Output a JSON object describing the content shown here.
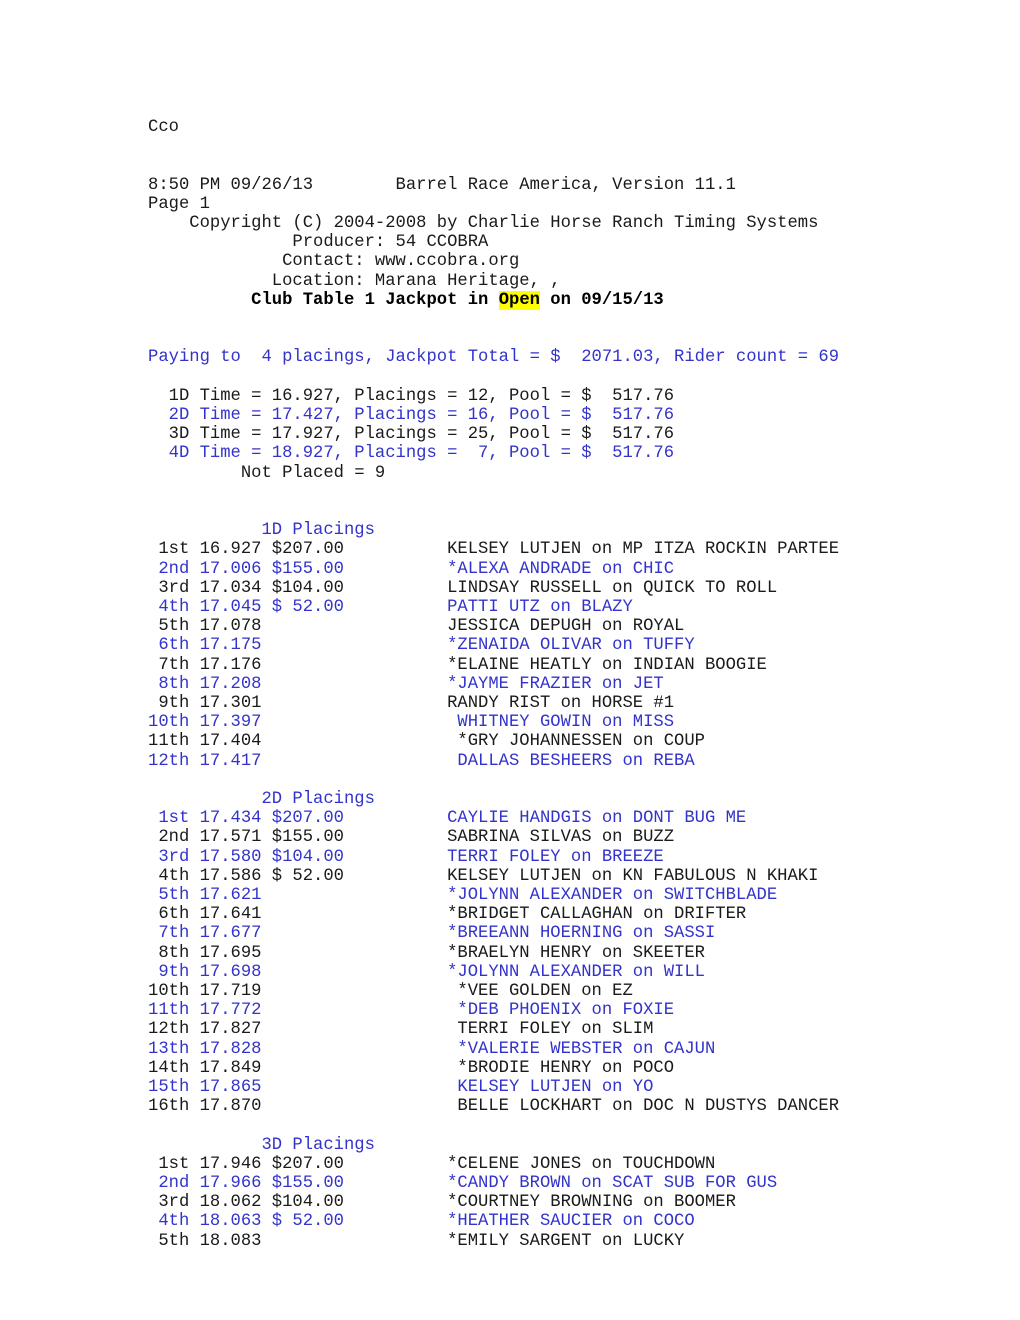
{
  "document": {
    "doc_label": "Cco",
    "timestamp_line": "8:50 PM 09/26/13",
    "app_title": "Barrel Race America, Version 11.1",
    "page_label": "Page 1",
    "copyright": "Copyright (C) 2004-2008 by Charlie Horse Ranch Timing Systems",
    "producer": "Producer: 54 CCOBRA",
    "contact": "Contact: www.ccobra.org",
    "location": "Location: Marana Heritage, ,",
    "title_prefix": "Club Table 1 Jackpot in ",
    "title_highlight": "Open",
    "title_suffix": " on 09/15/13"
  },
  "summary": {
    "paying_line": "Paying to  4 placings, Jackpot Total = $  2071.03, Rider count = 69",
    "divisions": [
      {
        "text": "1D Time = 16.927, Placings = 12, Pool = $  517.76",
        "color": "black"
      },
      {
        "text": "2D Time = 17.427, Placings = 16, Pool = $  517.76",
        "color": "blue"
      },
      {
        "text": "3D Time = 17.927, Placings = 25, Pool = $  517.76",
        "color": "black"
      },
      {
        "text": "4D Time = 18.927, Placings =  7, Pool = $  517.76",
        "color": "blue"
      }
    ],
    "not_placed": "Not Placed = 9"
  },
  "sections": [
    {
      "heading": "1D Placings",
      "rows": [
        {
          "left": " 1st 16.927 $207.00",
          "right": "KELSEY LUTJEN on MP ITZA ROCKIN PARTEE",
          "color": "black"
        },
        {
          "left": " 2nd 17.006 $155.00",
          "right": "*ALEXA ANDRADE on CHIC",
          "color": "blue"
        },
        {
          "left": " 3rd 17.034 $104.00",
          "right": "LINDSAY RUSSELL on QUICK TO ROLL",
          "color": "black"
        },
        {
          "left": " 4th 17.045 $ 52.00",
          "right": "PATTI UTZ on BLAZY",
          "color": "blue"
        },
        {
          "left": " 5th 17.078",
          "right": "JESSICA DEPUGH on ROYAL",
          "color": "black"
        },
        {
          "left": " 6th 17.175",
          "right": "*ZENAIDA OLIVAR on TUFFY",
          "color": "blue"
        },
        {
          "left": " 7th 17.176",
          "right": "*ELAINE HEATLY on INDIAN BOOGIE",
          "color": "black"
        },
        {
          "left": " 8th 17.208",
          "right": "*JAYME FRAZIER on JET",
          "color": "blue"
        },
        {
          "left": " 9th 17.301",
          "right": "RANDY RIST on HORSE #1",
          "color": "black"
        },
        {
          "left": "10th 17.397",
          "right": " WHITNEY GOWIN on MISS",
          "color": "blue"
        },
        {
          "left": "11th 17.404",
          "right": " *GRY JOHANNESSEN on COUP",
          "color": "black"
        },
        {
          "left": "12th 17.417",
          "right": " DALLAS BESHEERS on REBA",
          "color": "blue"
        }
      ]
    },
    {
      "heading": "2D Placings",
      "rows": [
        {
          "left": " 1st 17.434 $207.00",
          "right": "CAYLIE HANDGIS on DONT BUG ME",
          "color": "blue"
        },
        {
          "left": " 2nd 17.571 $155.00",
          "right": "SABRINA SILVAS on BUZZ",
          "color": "black"
        },
        {
          "left": " 3rd 17.580 $104.00",
          "right": "TERRI FOLEY on BREEZE",
          "color": "blue"
        },
        {
          "left": " 4th 17.586 $ 52.00",
          "right": "KELSEY LUTJEN on KN FABULOUS N KHAKI",
          "color": "black"
        },
        {
          "left": " 5th 17.621",
          "right": "*JOLYNN ALEXANDER on SWITCHBLADE",
          "color": "blue"
        },
        {
          "left": " 6th 17.641",
          "right": "*BRIDGET CALLAGHAN on DRIFTER",
          "color": "black"
        },
        {
          "left": " 7th 17.677",
          "right": "*BREEANN HOERNING on SASSI",
          "color": "blue"
        },
        {
          "left": " 8th 17.695",
          "right": "*BRAELYN HENRY on SKEETER",
          "color": "black"
        },
        {
          "left": " 9th 17.698",
          "right": "*JOLYNN ALEXANDER on WILL",
          "color": "blue"
        },
        {
          "left": "10th 17.719",
          "right": " *VEE GOLDEN on EZ",
          "color": "black"
        },
        {
          "left": "11th 17.772",
          "right": " *DEB PHOENIX on FOXIE",
          "color": "blue"
        },
        {
          "left": "12th 17.827",
          "right": " TERRI FOLEY on SLIM",
          "color": "black"
        },
        {
          "left": "13th 17.828",
          "right": " *VALERIE WEBSTER on CAJUN",
          "color": "blue"
        },
        {
          "left": "14th 17.849",
          "right": " *BRODIE HENRY on POCO",
          "color": "black"
        },
        {
          "left": "15th 17.865",
          "right": " KELSEY LUTJEN on YO",
          "color": "blue"
        },
        {
          "left": "16th 17.870",
          "right": " BELLE LOCKHART on DOC N DUSTYS DANCER",
          "color": "black"
        }
      ]
    },
    {
      "heading": "3D Placings",
      "rows": [
        {
          "left": " 1st 17.946 $207.00",
          "right": "*CELENE JONES on TOUCHDOWN",
          "color": "black"
        },
        {
          "left": " 2nd 17.966 $155.00",
          "right": "*CANDY BROWN on SCAT SUB FOR GUS",
          "color": "blue"
        },
        {
          "left": " 3rd 18.062 $104.00",
          "right": "*COURTNEY BROWNING on BOOMER",
          "color": "black"
        },
        {
          "left": " 4th 18.063 $ 52.00",
          "right": "*HEATHER SAUCIER on COCO",
          "color": "blue"
        },
        {
          "left": " 5th 18.083",
          "right": "*EMILY SARGENT on LUCKY",
          "color": "black"
        }
      ]
    }
  ],
  "colors": {
    "blue": "#3333cc",
    "black": "#1a1a1a",
    "highlight": "#ffff00"
  }
}
